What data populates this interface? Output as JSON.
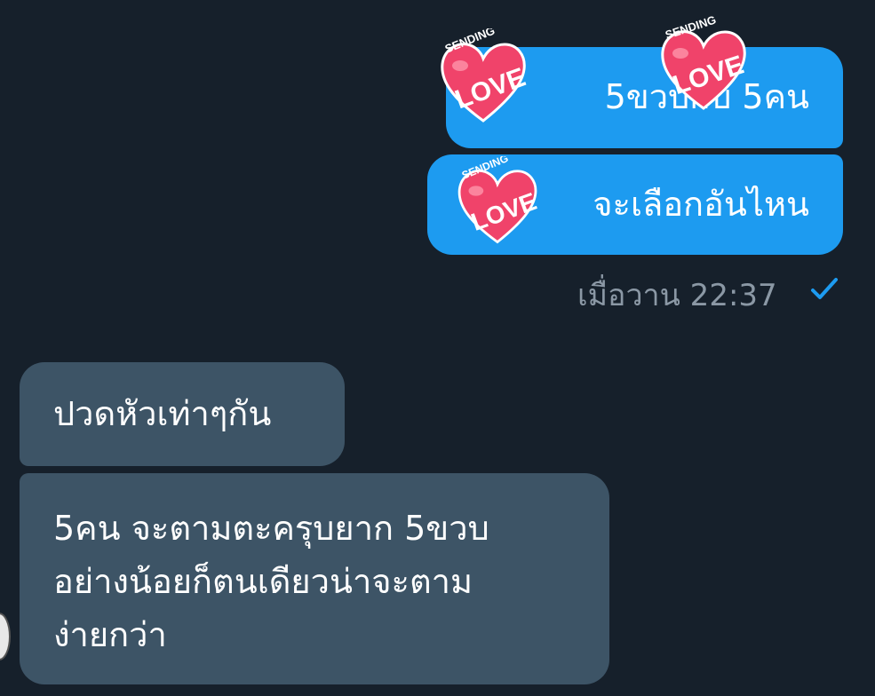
{
  "sent_messages": [
    {
      "text": "5ขวบกับ 5คน"
    },
    {
      "text": "จะเลือกอันไหน"
    }
  ],
  "sent_meta": {
    "timestamp": "เมื่อวาน 22:37",
    "status_icon": "check-icon"
  },
  "received_messages": [
    {
      "text": "ปวดหัวเท่าๆกัน"
    },
    {
      "lines": [
        "5คน จะตามตะครุบยาก 5ขวบ",
        "อย่างน้อยก็ตนเดียวน่าจะตาม",
        "ง่ายกว่า"
      ]
    }
  ],
  "stickers": [
    {
      "top": "SENDING",
      "main": "LOVE"
    },
    {
      "top": "SENDING",
      "main": "LOVE"
    },
    {
      "top": "SENDING",
      "main": "LOVE"
    }
  ],
  "colors": {
    "background": "#16202b",
    "sent_bubble": "#1d9bf0",
    "received_bubble": "#3d5466",
    "timestamp": "#8b98a5",
    "heart": "#f0436a"
  }
}
